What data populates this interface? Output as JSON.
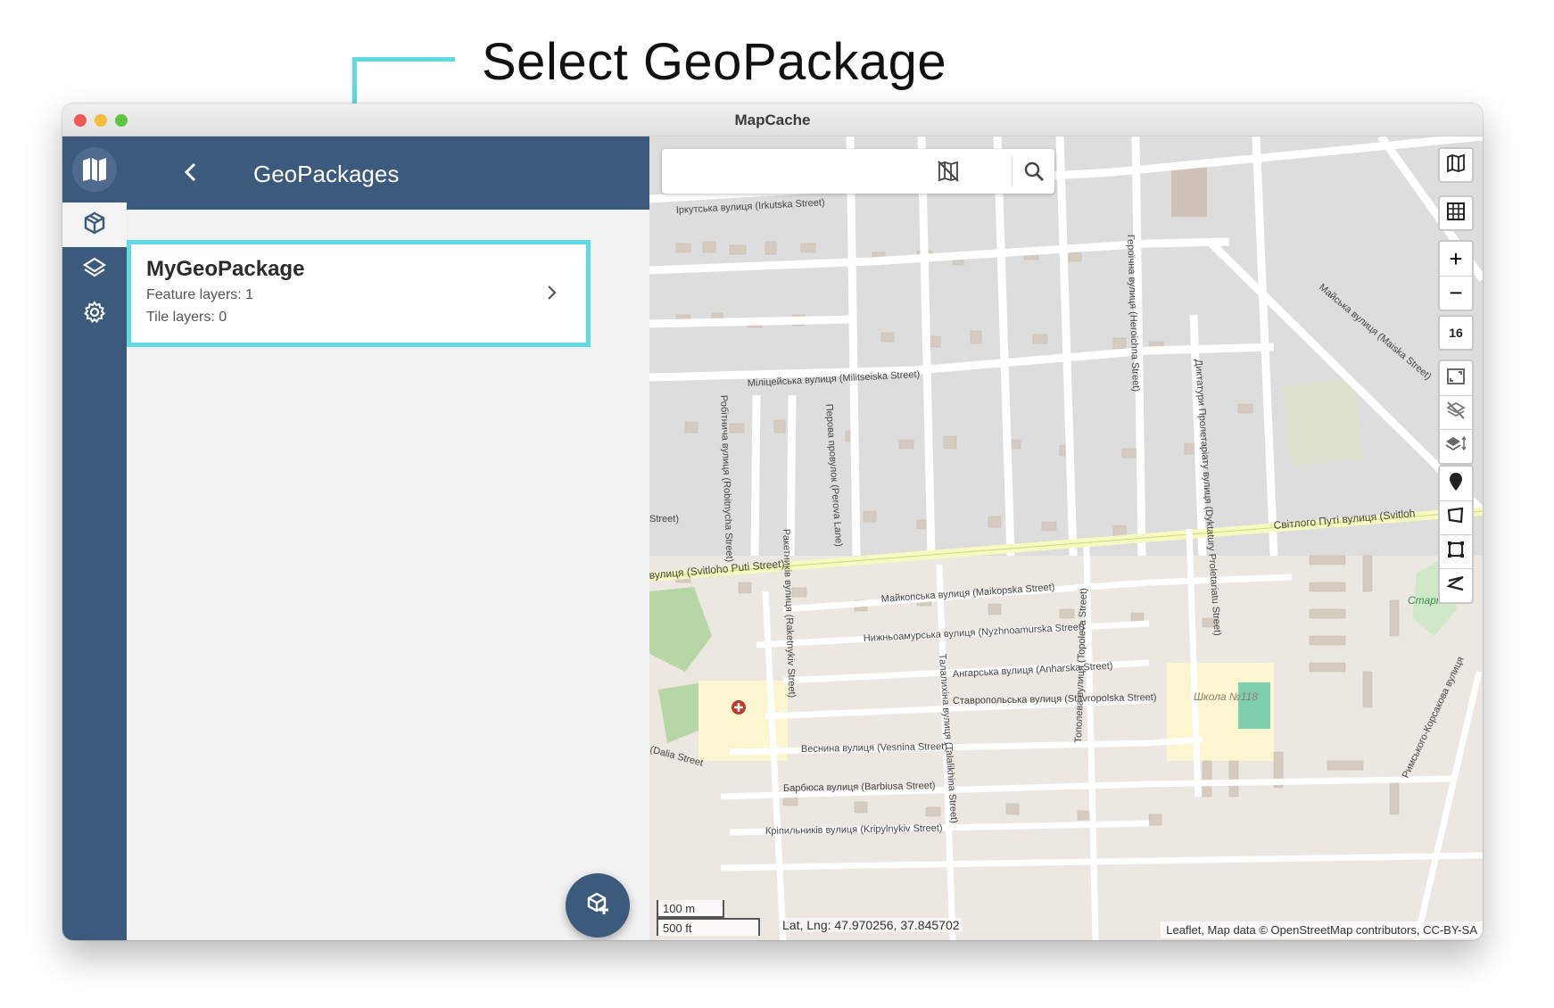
{
  "callout": {
    "title": "Select GeoPackage"
  },
  "window": {
    "title": "MapCache"
  },
  "rail": {
    "logo_icon": "mapcache-logo-icon",
    "items": [
      {
        "icon": "geopackage-cube-icon",
        "active": true
      },
      {
        "icon": "layers-icon",
        "active": false
      },
      {
        "icon": "gear-icon",
        "active": false
      }
    ]
  },
  "panel": {
    "header_title": "GeoPackages",
    "back_icon": "chevron-left-icon",
    "geopackage": {
      "name": "MyGeoPackage",
      "feature_layers": "Feature layers: 1",
      "tile_layers": "Tile layers: 0",
      "chevron_icon": "chevron-right-icon"
    },
    "fab_icon": "add-geopackage-icon"
  },
  "map": {
    "search": {
      "value": "",
      "placeholder": ""
    },
    "controls": {
      "basemap_icon": "map-icon",
      "grid_icon": "grid-icon",
      "zoom_in": "+",
      "zoom_out": "−",
      "zoom_level": "16",
      "fit_icon": "fit-bounds-icon",
      "disable_layers_icon": "layers-off-icon",
      "layer_order_icon": "layers-sort-icon",
      "marker_icon": "marker-icon",
      "polygon_icon": "polygon-icon",
      "rectangle_icon": "rectangle-icon",
      "line_icon": "polyline-icon"
    },
    "scale": {
      "metric": "100 m",
      "imperial": "500 ft"
    },
    "coordinates": "Lat, Lng: 47.970256, 37.845702",
    "attribution": "Leaflet, Map data © OpenStreetMap contributors, CC-BY-SA",
    "streets": [
      "Іркутська вулиця (Irkutska Street)",
      "Міліцейська вулиця (Militseiska Street)",
      "Робітнича вулиця (Robitnycha Street)",
      "Перова провулок (Perova Lane)",
      "Ракетників вулиця (Raketnykiv Street)",
      "вулиця (Svitloho Puti Street)",
      "Світлого Путі вулиця (Svitloh",
      "Майкопська вулиця (Maikopska Street)",
      "Нижньоамурська вулиця (Nyzhnoamurska Street)",
      "Ангарська вулиця (Anharska Street)",
      "Ставропольська вулиця (Stavropolska Street)",
      "Веснина вулиця (Vesnina Street)",
      "Барбюса вулиця (Barbiusa Street)",
      "Кріпильників вулиця (Kripylnykiv Street)",
      "Диктатури Пролетаріату вулиця (Dyktatury Proletariatu Street)",
      "Героїчна вулиця (Heroichna Street)",
      "Майська вулиця (Maiska Street)",
      "Римського-Корсакова вулиця",
      "Тополева вулиця (Topoleva Street)",
      "Талалихіна вулиця (Talalikhina Street)",
      "(Dalia Street",
      "Street)",
      "Школа №118",
      "Старт"
    ]
  }
}
